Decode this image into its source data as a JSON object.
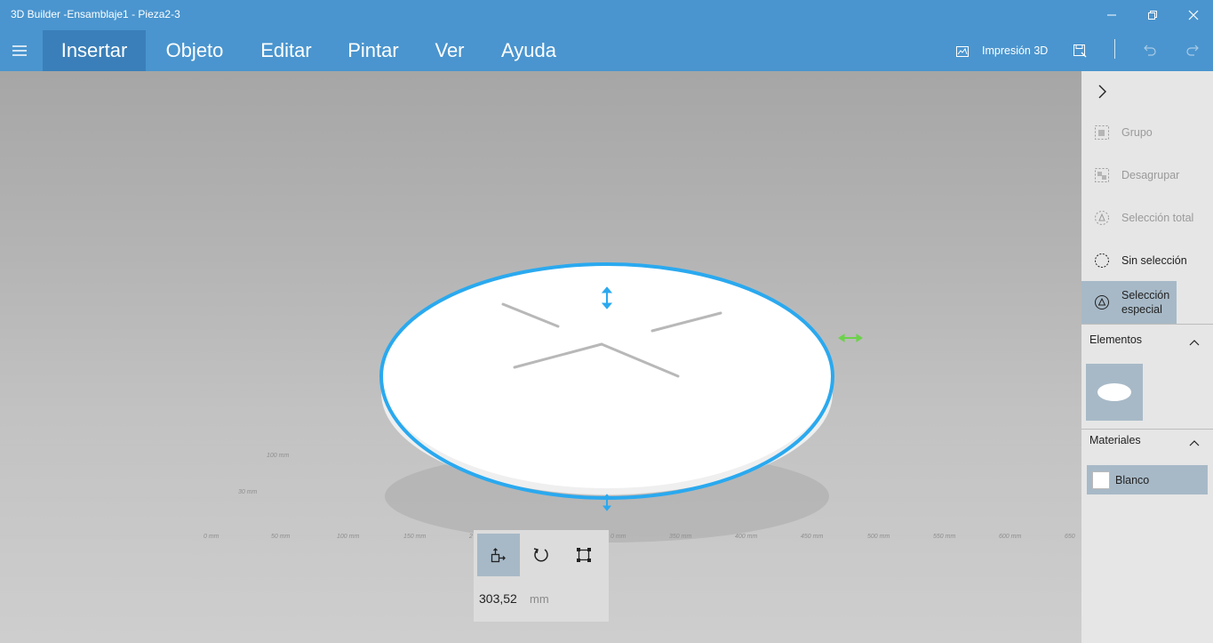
{
  "window": {
    "title": "3D Builder -Ensamblaje1 - Pieza2-3"
  },
  "menu": {
    "items": [
      {
        "label": "Insertar",
        "active": true
      },
      {
        "label": "Objeto",
        "active": false
      },
      {
        "label": "Editar",
        "active": false
      },
      {
        "label": "Pintar",
        "active": false
      },
      {
        "label": "Ver",
        "active": false
      },
      {
        "label": "Ayuda",
        "active": false
      }
    ],
    "print_label": "Impresión 3D"
  },
  "viewport": {
    "ruler_labels": [
      "0 mm",
      "50 mm",
      "100 mm",
      "150 mm",
      "2",
      "0 mm",
      "350 mm",
      "400 mm",
      "450 mm",
      "500 mm",
      "550 mm",
      "600 mm",
      "650"
    ],
    "depth_labels": [
      "30 mm",
      "100 mm"
    ]
  },
  "tool_panel": {
    "size_value": "303,52",
    "size_unit": "mm",
    "tools": [
      "move-icon",
      "rotate-icon",
      "scale-icon"
    ]
  },
  "side_panel": {
    "actions": [
      {
        "label": "Grupo",
        "enabled": false,
        "icon": "group-icon"
      },
      {
        "label": "Desagrupar",
        "enabled": false,
        "icon": "ungroup-icon"
      },
      {
        "label": "Selección total",
        "enabled": false,
        "icon": "select-all-icon"
      },
      {
        "label": "Sin selección",
        "enabled": true,
        "icon": "deselect-icon"
      },
      {
        "label": "Selección especial",
        "enabled": true,
        "icon": "special-selection-icon"
      }
    ],
    "elements_title": "Elementos",
    "materials_title": "Materiales",
    "materials": [
      {
        "label": "Blanco",
        "color": "#ffffff"
      }
    ]
  },
  "colors": {
    "titlebar": "#4a95cf",
    "active_menu": "#3a7fb9",
    "selection": "#2aa9ef",
    "highlight": "#a7b9c7"
  }
}
